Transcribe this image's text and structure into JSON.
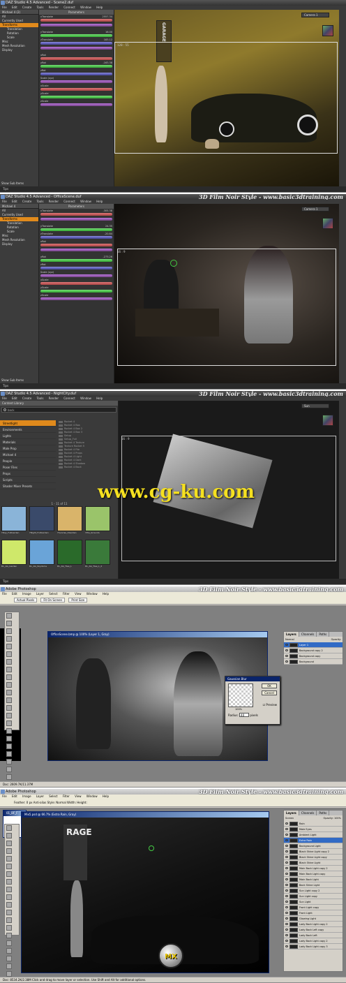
{
  "brand_title": "3D Film Noir Style - www.basic3dtraining.com",
  "daz_menu": [
    "File",
    "Edit",
    "Create",
    "Tools",
    "Render",
    "Connect",
    "Window",
    "Help"
  ],
  "ps_menu": [
    "File",
    "Edit",
    "Image",
    "Layer",
    "Select",
    "Filter",
    "View",
    "Window",
    "Help"
  ],
  "panel1": {
    "title": "DAZ Studio 4.5 Advanced - Scene2.duf",
    "node": "Michael 4 (2)",
    "tab": "Parameters",
    "tree": [
      "All",
      "Currently Used",
      "Transforms",
      "Translation",
      "Rotation",
      "Scale",
      "Misc",
      "Mesh Resolution",
      "Display"
    ],
    "tree_selected": "Transforms",
    "show_sub": "Show Sub Items",
    "params": [
      {
        "label": "xTranslate",
        "value": "2557.34",
        "color": "red"
      },
      {
        "label": "",
        "value": "",
        "color": "purple"
      },
      {
        "label": "yTranslate",
        "value": "16.00",
        "color": "green"
      },
      {
        "label": "zTranslate",
        "value": "183.12",
        "color": "blue"
      },
      {
        "label": "",
        "value": "",
        "color": "purple"
      },
      {
        "label": "xRot",
        "value": "",
        "color": "red"
      },
      {
        "label": "yRot",
        "value": "-163.38",
        "color": "green"
      },
      {
        "label": "zRot",
        "value": "",
        "color": "blue"
      },
      {
        "label": "Scale (xyz)",
        "value": "",
        "color": "purple"
      },
      {
        "label": "xScale",
        "value": "",
        "color": "red"
      },
      {
        "label": "yScale",
        "value": "",
        "color": "green"
      },
      {
        "label": "zScale",
        "value": "",
        "color": "purple"
      }
    ],
    "camera": "Camera 1",
    "frame": "128 : 55",
    "sign": "GARAGE",
    "status": "Tips"
  },
  "panel2": {
    "title": "DAZ Studio 4.5 Advanced - OfficeScene.duf",
    "node": "Michael 4",
    "tab": "Parameters",
    "tree": [
      "All",
      "Currently Used",
      "Transforms",
      "Translation",
      "Rotation",
      "Scale",
      "Misc",
      "Mesh Resolution",
      "Display"
    ],
    "tree_selected": "Transforms",
    "show_sub": "Show Sub Items",
    "params": [
      {
        "label": "xTranslate",
        "value": "-305.38",
        "color": "red"
      },
      {
        "label": "",
        "value": "",
        "color": "purple"
      },
      {
        "label": "yTranslate",
        "value": "24.35",
        "color": "green"
      },
      {
        "label": "zTranslate",
        "value": "-20.84",
        "color": "blue"
      },
      {
        "label": "xRot",
        "value": "",
        "color": "red"
      },
      {
        "label": "",
        "value": "",
        "color": "purple"
      },
      {
        "label": "yRot",
        "value": "-273.26",
        "color": "green"
      },
      {
        "label": "zRot",
        "value": "",
        "color": "blue"
      },
      {
        "label": "Scale (xyz)",
        "value": "",
        "color": "purple"
      },
      {
        "label": "xScale",
        "value": "",
        "color": "red"
      },
      {
        "label": "yScale",
        "value": "",
        "color": "green"
      },
      {
        "label": "zScale",
        "value": "",
        "color": "purple"
      }
    ],
    "camera": "Camera 1",
    "frame": "16 : 9",
    "status": "Tips"
  },
  "panel3": {
    "title": "DAZ Studio 4.5 Advanced - NightCity.duf",
    "tab": "Content Library",
    "search": "back",
    "tree": [
      "Streetlight",
      "Environments",
      "Lights",
      "Materials",
      "Male Prop",
      "Michael 4",
      "People",
      "Poser Files",
      "Props",
      "Scripts",
      "Shader Mixer Presets"
    ],
    "tree_selected": "Streetlight",
    "files": [
      "Rocket 4",
      "Rocket 4 Box",
      "Rocket 4 Box 2",
      "Rocket 4 Box 3",
      "Setup",
      "Setup_Full",
      "Rocket 4 Texture",
      "Texture Rocket 5",
      "Rocket 4 File",
      "Rocket 4 Props",
      "Rocket 4 Light",
      "Rocket 4 Dark",
      "Rocket 4 Shadow",
      "Rocket 4 Back"
    ],
    "count": "1 - 11 of 11",
    "thumbs": [
      {
        "cap": "YDay_FullGarden",
        "color": "#8ab4d8"
      },
      {
        "cap": "YNight_FullGarden",
        "color": "#3a4a6a"
      },
      {
        "cap": "YSunrise_XGarden",
        "color": "#d9b46a"
      },
      {
        "cap": "YPre_Grounds",
        "color": "#9ac46a"
      },
      {
        "cap": "DL_AG_Garden",
        "color": "#cfe86a"
      },
      {
        "cap": "DL_AG_Skydome",
        "color": "#6aa4d8"
      },
      {
        "cap": "DL_AG_Tree_L",
        "color": "#2a6a2a"
      },
      {
        "cap": "DL_AG_Tree_L_2",
        "color": "#3a7a3a"
      }
    ],
    "camera": "Sun",
    "frame": "16 : 9",
    "watermark": "www.cg-ku.com",
    "status": "Tips"
  },
  "panel4": {
    "title": "Adobe Photoshop",
    "opts": [
      "Actual Pixels",
      "Fit On Screen",
      "Print Size"
    ],
    "doc_title": "OfficeScene.bmp @ 100% (Layer 1, Gray)",
    "layers_tabs": [
      "Layers",
      "Channels",
      "Paths"
    ],
    "blend": "Normal",
    "opacity": "Opacity:",
    "layers": [
      "Layer 1",
      "Background copy 2",
      "Background copy",
      "Background"
    ],
    "layer_selected": "Layer 1",
    "dialog": {
      "title": "Gaussian Blur",
      "ok": "OK",
      "cancel": "Cancel",
      "preview": "Preview",
      "pct": "100%",
      "radius_label": "Radius:",
      "radius": "40",
      "unit": "pixels"
    },
    "status": "Doc: 2609.7K/11.37M"
  },
  "panel5": {
    "title": "Adobe Photoshop",
    "opts_text": "Feather: 0 px   Anti-alias   Style: Normal   Width:   Height:",
    "doc_title": "Mix5.psd @ 66.7% (Extra Rain, Gray)",
    "side_doc": "01_BF_F",
    "layers_tabs": [
      "Layers",
      "Channels",
      "Paths"
    ],
    "blend": "Screen",
    "opacity": "Opacity: 100%",
    "layers": [
      "Rain",
      "Male Eyes",
      "Ambient Light",
      "Extra Rain",
      "Background Light",
      "Black Shine Light copy 2",
      "Black Shine Light copy",
      "Black Shine Light",
      "Main Back Light copy 2",
      "Main Back Light copy",
      "Main Back Light",
      "Back Shine Light",
      "Sun Light copy 2",
      "Sun Light copy",
      "Sun Light",
      "Front Light copy",
      "Front Light",
      "Glowing Light",
      "Lady Back Light copy 2",
      "Lady Back Left copy",
      "Lady Back Left",
      "Lady Back Light copy 2",
      "Lady Back Light copy 3"
    ],
    "layer_selected": "Extra Rain",
    "sign": "RAGE",
    "logo": "MX",
    "status": "Doc: 8534.2K/2.38M   Click and drag to move layer or selection. Use Shift and Alt for additional options."
  },
  "colors": {
    "accent": "#e08a1c",
    "ps_title": "#0a246a",
    "watermark": "#f5e020"
  },
  "icons": [
    "app-icon",
    "search-icon",
    "eye-icon",
    "cube-gizmo-icon",
    "nav-arrow-icon",
    "logo-icon"
  ]
}
